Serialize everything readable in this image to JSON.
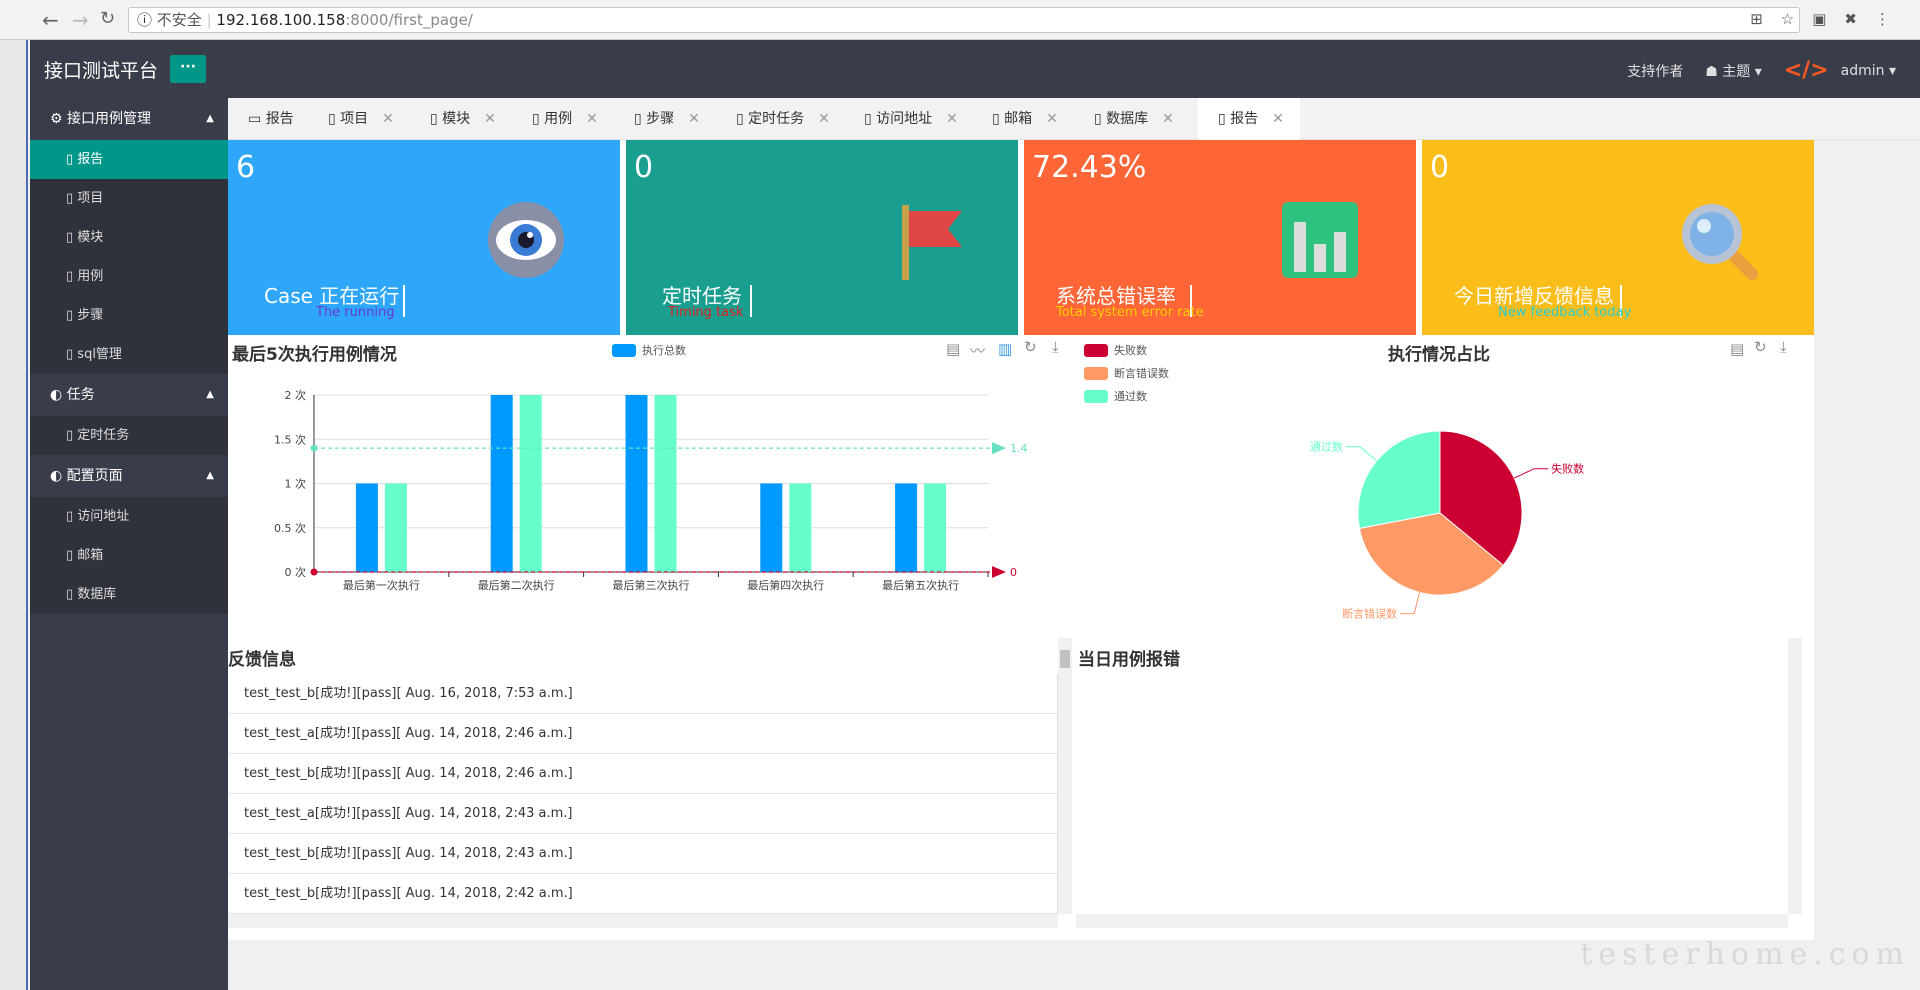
{
  "browser": {
    "insecure_label": "不安全",
    "url_host": "192.168.100.158",
    "url_path": ":8000/first_page/"
  },
  "header": {
    "brand": "接口测试平台",
    "more": "···",
    "support": "支持作者",
    "theme": "主题",
    "user": "admin"
  },
  "sidebar": {
    "groups": [
      {
        "label": "接口用例管理",
        "items": [
          "报告",
          "项目",
          "模块",
          "用例",
          "步骤",
          "sql管理"
        ]
      },
      {
        "label": "任务",
        "items": [
          "定时任务"
        ]
      },
      {
        "label": "配置页面",
        "items": [
          "访问地址",
          "邮箱",
          "数据库"
        ]
      }
    ]
  },
  "tabs": [
    "报告",
    "项目",
    "模块",
    "用例",
    "步骤",
    "定时任务",
    "访问地址",
    "邮箱",
    "数据库",
    "报告"
  ],
  "cards": [
    {
      "num": "6",
      "label": "Case 正在运行",
      "sub": "The running",
      "color": "#2ea7fa",
      "subcolor": "#6a3ad0"
    },
    {
      "num": "0",
      "label": "定时任务",
      "sub": "Timing task",
      "color": "#1a9e8f",
      "subcolor": "#e02020"
    },
    {
      "num": "72.43%",
      "label": "系统总错误率",
      "sub": "Total system error rate",
      "color": "#fe6637",
      "subcolor": "#ffcc00"
    },
    {
      "num": "0",
      "label": "今日新增反馈信息",
      "sub": "New feedback today",
      "color": "#fbbd19",
      "subcolor": "#22cfd6"
    }
  ],
  "bar_panel": {
    "title": "最后5次执行用例情况",
    "legend": "执行总数"
  },
  "pie_panel": {
    "title": "执行情况占比"
  },
  "chart_data": [
    {
      "type": "bar",
      "categories": [
        "最后第一次执行",
        "最后第二次执行",
        "最后第三次执行",
        "最后第四次执行",
        "最后第五次执行"
      ],
      "series": [
        {
          "name": "执行总数",
          "values": [
            1,
            2,
            2,
            1,
            1
          ],
          "color": "#0099ff"
        },
        {
          "name": "",
          "values": [
            1,
            2,
            2,
            1,
            1
          ],
          "color": "#66ffcc"
        }
      ],
      "yticks": [
        "0 次",
        "0.5 次",
        "1 次",
        "1.5 次",
        "2 次"
      ],
      "ylim": [
        0,
        2
      ],
      "mark_lines": [
        {
          "value": 1.4,
          "label": "1.4",
          "color": "#66e0c0"
        },
        {
          "value": 0,
          "label": "0",
          "color": "#cc0033"
        }
      ]
    },
    {
      "type": "pie",
      "labels": [
        "失败数",
        "断言错误数",
        "通过数"
      ],
      "values": [
        36,
        36,
        28
      ],
      "colors": [
        "#cc0033",
        "#ff9966",
        "#66ffcc"
      ]
    }
  ],
  "feedback": {
    "title": "反馈信息",
    "rows": [
      "test_test_b[成功!][pass][ Aug. 16, 2018, 7:53 a.m.]",
      "test_test_a[成功!][pass][ Aug. 14, 2018, 2:46 a.m.]",
      "test_test_b[成功!][pass][ Aug. 14, 2018, 2:46 a.m.]",
      "test_test_a[成功!][pass][ Aug. 14, 2018, 2:43 a.m.]",
      "test_test_b[成功!][pass][ Aug. 14, 2018, 2:43 a.m.]",
      "test_test_b[成功!][pass][ Aug. 14, 2018, 2:42 a.m.]"
    ]
  },
  "errors": {
    "title": "当日用例报错"
  },
  "watermark": "testerhome.com"
}
